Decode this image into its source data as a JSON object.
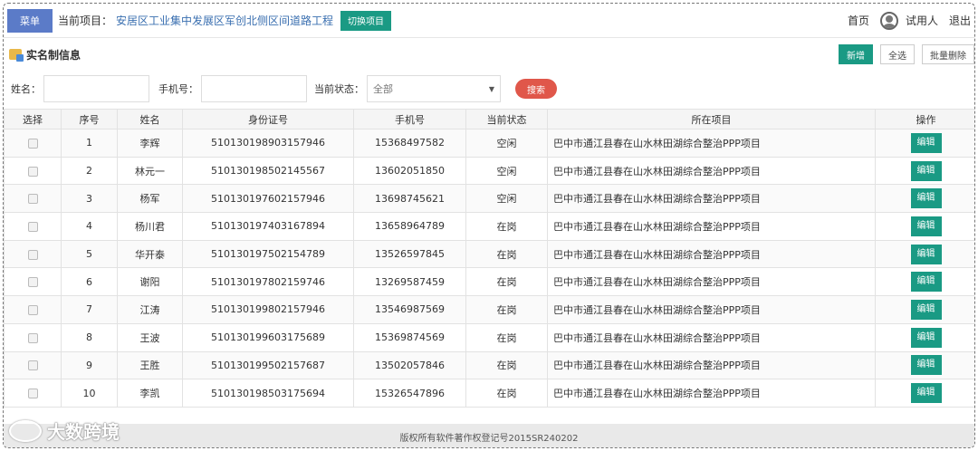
{
  "header": {
    "menu_label": "菜单",
    "current_label": "当前项目：",
    "current_project": "安居区工业集中发展区军创北侧区间道路工程",
    "switch_label": "切换项目",
    "home_label": "首页",
    "user_label": "试用人",
    "logout_label": "退出"
  },
  "section": {
    "title": "实名制信息",
    "new_label": "新增",
    "select_all_label": "全选",
    "batch_delete_label": "批量删除"
  },
  "search": {
    "name_label": "姓名：",
    "name_value": "",
    "phone_label": "手机号：",
    "phone_value": "",
    "status_label": "当前状态：",
    "status_selected": "全部",
    "search_label": "搜索"
  },
  "table": {
    "headers": [
      "选择",
      "序号",
      "姓名",
      "身份证号",
      "手机号",
      "当前状态",
      "所在项目",
      "操作"
    ],
    "edit_label": "编辑",
    "rows": [
      {
        "no": "1",
        "name": "李辉",
        "id": "510130198903157946",
        "phone": "15368497582",
        "status": "空闲",
        "project": "巴中市通江县春在山水林田湖综合整治PPP项目"
      },
      {
        "no": "2",
        "name": "林元一",
        "id": "510130198502145567",
        "phone": "13602051850",
        "status": "空闲",
        "project": "巴中市通江县春在山水林田湖综合整治PPP项目"
      },
      {
        "no": "3",
        "name": "杨军",
        "id": "510130197602157946",
        "phone": "13698745621",
        "status": "空闲",
        "project": "巴中市通江县春在山水林田湖综合整治PPP项目"
      },
      {
        "no": "4",
        "name": "杨川君",
        "id": "510130197403167894",
        "phone": "13658964789",
        "status": "在岗",
        "project": "巴中市通江县春在山水林田湖综合整治PPP项目"
      },
      {
        "no": "5",
        "name": "华开泰",
        "id": "510130197502154789",
        "phone": "13526597845",
        "status": "在岗",
        "project": "巴中市通江县春在山水林田湖综合整治PPP项目"
      },
      {
        "no": "6",
        "name": "谢阳",
        "id": "510130197802159746",
        "phone": "13269587459",
        "status": "在岗",
        "project": "巴中市通江县春在山水林田湖综合整治PPP项目"
      },
      {
        "no": "7",
        "name": "江涛",
        "id": "510130199802157946",
        "phone": "13546987569",
        "status": "在岗",
        "project": "巴中市通江县春在山水林田湖综合整治PPP项目"
      },
      {
        "no": "8",
        "name": "王波",
        "id": "510130199603175689",
        "phone": "15369874569",
        "status": "在岗",
        "project": "巴中市通江县春在山水林田湖综合整治PPP项目"
      },
      {
        "no": "9",
        "name": "王胜",
        "id": "510130199502157687",
        "phone": "13502057846",
        "status": "在岗",
        "project": "巴中市通江县春在山水林田湖综合整治PPP项目"
      },
      {
        "no": "10",
        "name": "李凯",
        "id": "510130198503175694",
        "phone": "15326547896",
        "status": "在岗",
        "project": "巴中市通江县春在山水林田湖综合整治PPP项目"
      }
    ]
  },
  "footer": {
    "copyright": "版权所有软件著作权登记号2015SR240202"
  },
  "watermark": {
    "text": "大数跨境"
  }
}
